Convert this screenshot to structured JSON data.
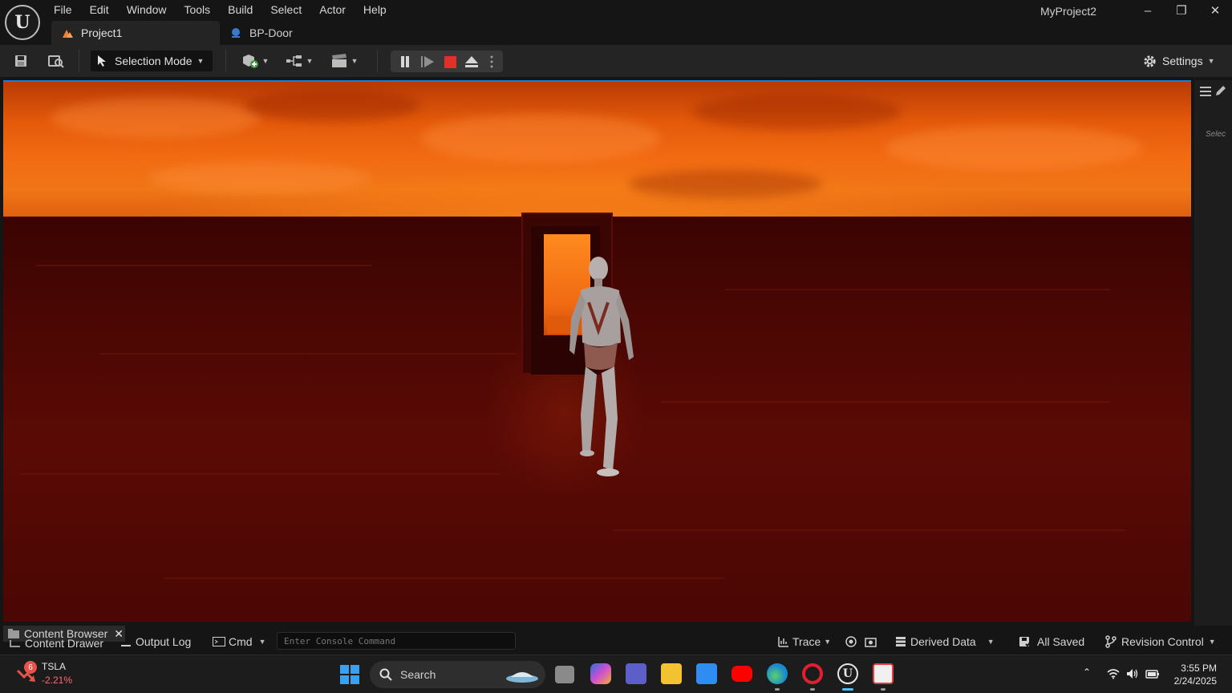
{
  "app": {
    "project_title": "MyProject2",
    "menu": [
      "File",
      "Edit",
      "Window",
      "Tools",
      "Build",
      "Select",
      "Actor",
      "Help"
    ],
    "tabs": [
      {
        "label": "Project1",
        "active": true
      },
      {
        "label": "BP-Door",
        "active": false
      }
    ]
  },
  "toolbar": {
    "selection_mode_label": "Selection Mode",
    "settings_label": "Settings"
  },
  "right_panel": {
    "tab_partial_label": "Selec"
  },
  "bottom_bar": {
    "content_browser_label": "Content Browser",
    "content_drawer_label": "Content Drawer",
    "output_log_label": "Output Log",
    "cmd_label": "Cmd",
    "console_placeholder": "Enter Console Command",
    "trace_label": "Trace",
    "derived_data_label": "Derived Data",
    "all_saved_label": "All Saved",
    "revision_control_label": "Revision Control"
  },
  "taskbar": {
    "stock_ticker": "TSLA",
    "stock_change": "-2.21%",
    "notification_count": "6",
    "search_label": "Search",
    "time": "3:55 PM",
    "date": "2/24/2025"
  },
  "colors": {
    "accent": "#1a7fd4",
    "stop_red": "#e0302a",
    "sky_orange": "#f06a12",
    "ground_red": "#4a0703"
  }
}
